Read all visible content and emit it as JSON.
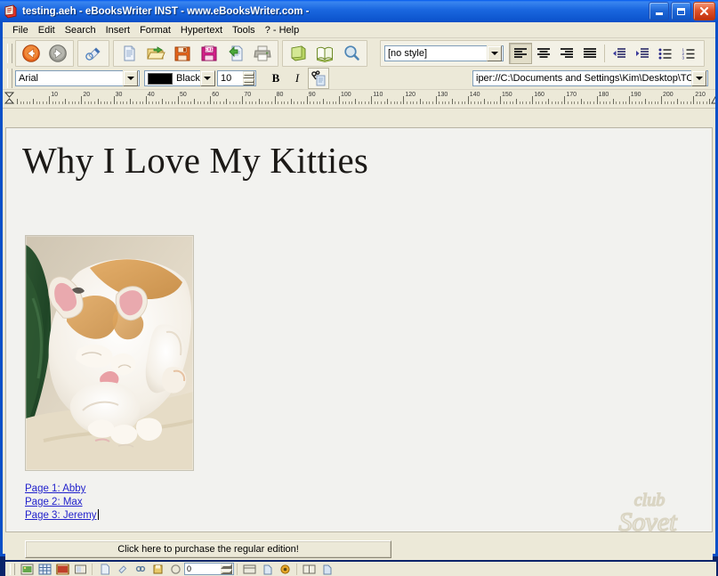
{
  "window": {
    "title": "testing.aeh - eBooksWriter INST - www.eBooksWriter.com -",
    "icon": "book-app-icon",
    "buttons": {
      "minimize": "minimize-button",
      "maximize": "maximize-button",
      "close": "close-button"
    }
  },
  "menu": {
    "items": [
      {
        "label": "File",
        "accel": "F"
      },
      {
        "label": "Edit",
        "accel": "E"
      },
      {
        "label": "Search",
        "accel": "S"
      },
      {
        "label": "Insert",
        "accel": "I"
      },
      {
        "label": "Format",
        "accel": "o"
      },
      {
        "label": "Hypertext",
        "accel": "t"
      },
      {
        "label": "Tools",
        "accel": "T"
      },
      {
        "label": "? - Help",
        "accel": "?"
      }
    ]
  },
  "toolbar_main": {
    "groups": [
      {
        "name": "navigation",
        "buttons": [
          {
            "name": "back-icon",
            "tooltip": "Back"
          },
          {
            "name": "forward-icon",
            "tooltip": "Forward"
          }
        ]
      },
      {
        "name": "edit-project",
        "buttons": [
          {
            "name": "edit-pencil-icon",
            "tooltip": "Edit"
          }
        ]
      },
      {
        "name": "file-operations",
        "buttons": [
          {
            "name": "new-document-icon",
            "tooltip": "New"
          },
          {
            "name": "open-folder-icon",
            "tooltip": "Open"
          },
          {
            "name": "save-floppy-icon",
            "tooltip": "Save"
          },
          {
            "name": "save-exe-floppy-icon",
            "tooltip": "Save as EXE"
          },
          {
            "name": "export-page-icon",
            "tooltip": "Export"
          },
          {
            "name": "print-icon",
            "tooltip": "Print"
          }
        ]
      },
      {
        "name": "book-view",
        "buttons": [
          {
            "name": "closed-book-icon",
            "tooltip": "Book"
          },
          {
            "name": "open-book-icon",
            "tooltip": "Preview"
          },
          {
            "name": "magnifier-icon",
            "tooltip": "Zoom"
          }
        ]
      }
    ]
  },
  "toolbar_style": {
    "style_combo": {
      "value": "[no style]",
      "name": "paragraph-style-combo"
    },
    "align_buttons": [
      {
        "name": "align-left-button",
        "active": true
      },
      {
        "name": "align-center-button",
        "active": false
      },
      {
        "name": "align-right-button",
        "active": false
      },
      {
        "name": "align-justify-button",
        "active": false
      }
    ],
    "indent_buttons": [
      {
        "name": "outdent-button"
      },
      {
        "name": "indent-button"
      },
      {
        "name": "bullet-list-button"
      },
      {
        "name": "numbered-list-button"
      }
    ]
  },
  "toolbar_font": {
    "font_family": {
      "value": "Arial",
      "name": "font-family-combo"
    },
    "font_color": {
      "label": "Black",
      "hex": "#000000",
      "name": "font-color-combo"
    },
    "font_size": {
      "value": "10",
      "name": "font-size-spinner"
    },
    "bold": {
      "label": "B",
      "name": "bold-button"
    },
    "italic": {
      "label": "I",
      "name": "italic-button"
    },
    "link": {
      "name": "hyperlink-icon"
    }
  },
  "address_bar": {
    "value": "iper://C:\\Documents and Settings\\Kim\\Desktop\\TO D",
    "name": "address-combo"
  },
  "ruler": {
    "unit_labels": [
      "10",
      "20",
      "30",
      "40",
      "50",
      "60",
      "70",
      "80",
      "90",
      "100",
      "110",
      "120",
      "130",
      "140",
      "150",
      "160",
      "170",
      "180",
      "190",
      "200",
      "210"
    ],
    "left_marker": "indent-marker-left",
    "right_marker": "indent-marker-right"
  },
  "document": {
    "title": "Why I Love My Kitties",
    "image": {
      "name": "sleeping-cat-photo",
      "alt": "Sleeping orange and white cat on a green blanket"
    },
    "links": [
      {
        "text": "Page 1: Abby",
        "name": "doc-link-page-1"
      },
      {
        "text": "Page 2: Max",
        "name": "doc-link-page-2"
      },
      {
        "text": "Page 3: Jeremy",
        "name": "doc-link-page-3"
      }
    ]
  },
  "purchase": {
    "label": "Click here to purchase the regular edition!",
    "name": "purchase-regular-edition-button"
  },
  "watermark": {
    "line1": "club",
    "line2": "Sovet"
  },
  "bottom_bar": {
    "page_number": "0",
    "buttons": [
      {
        "name": "insert-image-icon"
      },
      {
        "name": "insert-table-icon"
      },
      {
        "name": "insert-media-icon"
      },
      {
        "name": "insert-frame-icon"
      },
      {
        "name": "page-new-icon"
      },
      {
        "name": "page-edit-icon"
      },
      {
        "name": "page-link-icon"
      },
      {
        "name": "page-save-icon"
      },
      {
        "name": "page-prev-icon"
      },
      {
        "name": "page-next-icon"
      },
      {
        "name": "page-goto-icon"
      },
      {
        "name": "anchor-icon"
      },
      {
        "name": "split-view-icon"
      },
      {
        "name": "preview-icon"
      }
    ]
  },
  "colors": {
    "title_bar_blue": "#0a50c8",
    "window_face": "#ece9d8",
    "doc_background": "#f2f2ef",
    "link_blue": "#2222cc"
  }
}
